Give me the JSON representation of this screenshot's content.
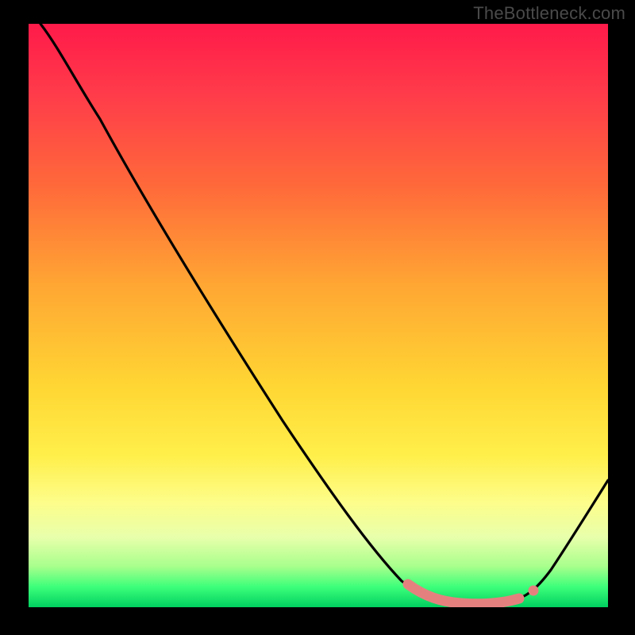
{
  "attribution": "TheBottleneck.com",
  "colors": {
    "background": "#000000",
    "gradient_top": "#ff1a4a",
    "gradient_mid1": "#ff6a3a",
    "gradient_mid2": "#ffd633",
    "gradient_mid3": "#fdfd8a",
    "gradient_bottom": "#00d060",
    "curve_stroke": "#000000",
    "marker_fill": "#e4817f",
    "attribution_text": "#4a4a4a"
  },
  "chart_data": {
    "type": "line",
    "title": "",
    "xlabel": "",
    "ylabel": "",
    "xlim": [
      0,
      100
    ],
    "ylim": [
      0,
      100
    ],
    "series": [
      {
        "name": "bottleneck-curve",
        "x": [
          2,
          5,
          10,
          20,
          30,
          40,
          50,
          60,
          65,
          68,
          72,
          76,
          80,
          83,
          86,
          90,
          95,
          100
        ],
        "y": [
          100,
          98,
          92,
          78,
          64,
          50,
          36,
          22,
          14,
          9,
          4,
          1.5,
          0.8,
          0.8,
          1.5,
          5,
          13,
          22
        ]
      }
    ],
    "markers": {
      "name": "highlight-valley",
      "x": [
        68,
        70,
        72,
        74,
        76,
        78,
        80,
        82,
        84,
        86
      ],
      "y": [
        4.5,
        3,
        2,
        1.4,
        1.0,
        0.8,
        0.8,
        0.9,
        1.3,
        2.2
      ]
    }
  }
}
